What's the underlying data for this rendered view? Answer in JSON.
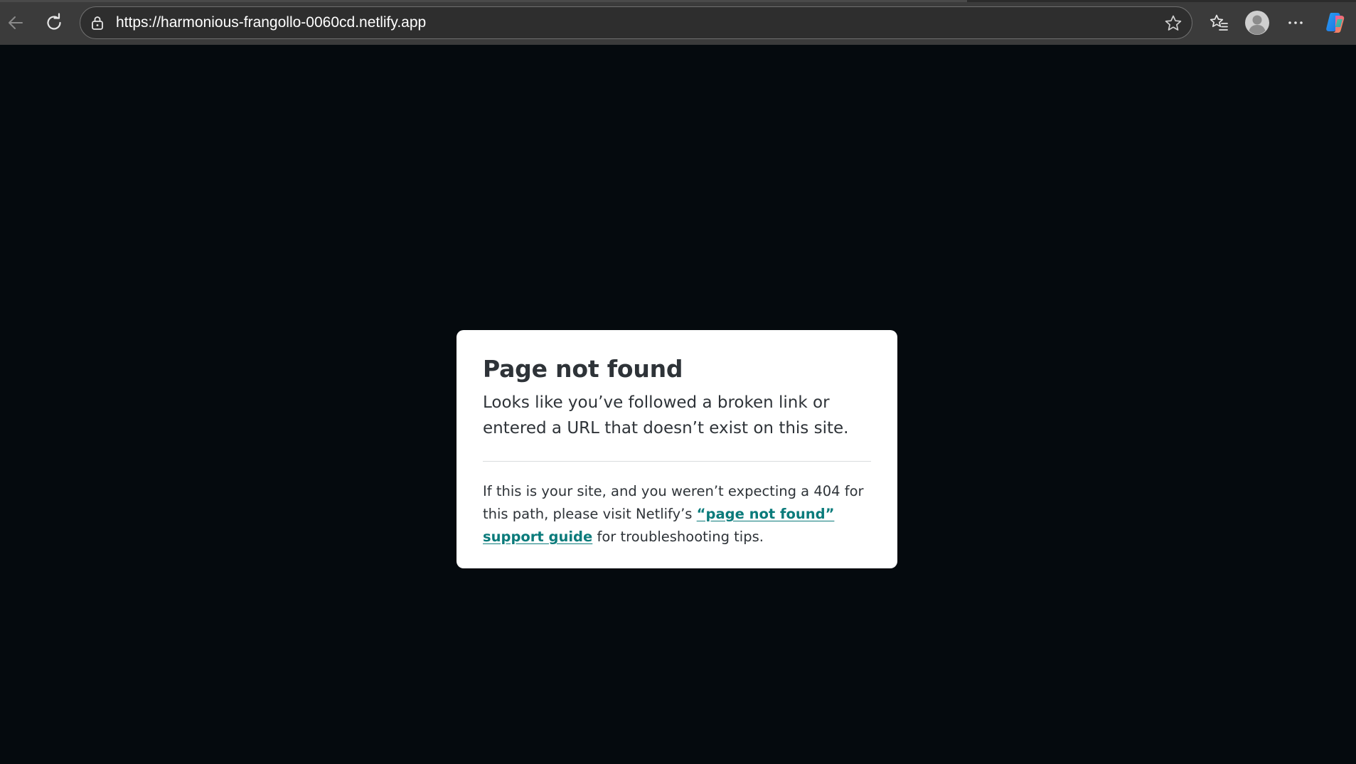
{
  "browser": {
    "url": "https://harmonious-frangollo-0060cd.netlify.app",
    "icons": {
      "back": "arrow-left-icon",
      "reload": "reload-icon",
      "lock": "lock-icon",
      "favorite": "star-icon",
      "favorites_list": "favorites-icon",
      "profile": "profile-icon",
      "more": "more-icon",
      "copilot": "copilot-icon"
    },
    "colors": {
      "toolbar_bg": "#3b3b3b",
      "address_bg": "#2e2e2e",
      "page_bg": "#050a0e"
    }
  },
  "card": {
    "title": "Page not found",
    "lead": "Looks like you’ve followed a broken link or entered a URL that doesn’t exist on this site.",
    "body_before": "If this is your site, and you weren’t expecting a 404 for this path, please visit Netlify’s ",
    "link_text": "“page not found” support guide",
    "body_after": " for troubleshooting tips.",
    "colors": {
      "card_bg": "#ffffff",
      "text": "#2e3338",
      "link": "#0b7b7b"
    }
  }
}
